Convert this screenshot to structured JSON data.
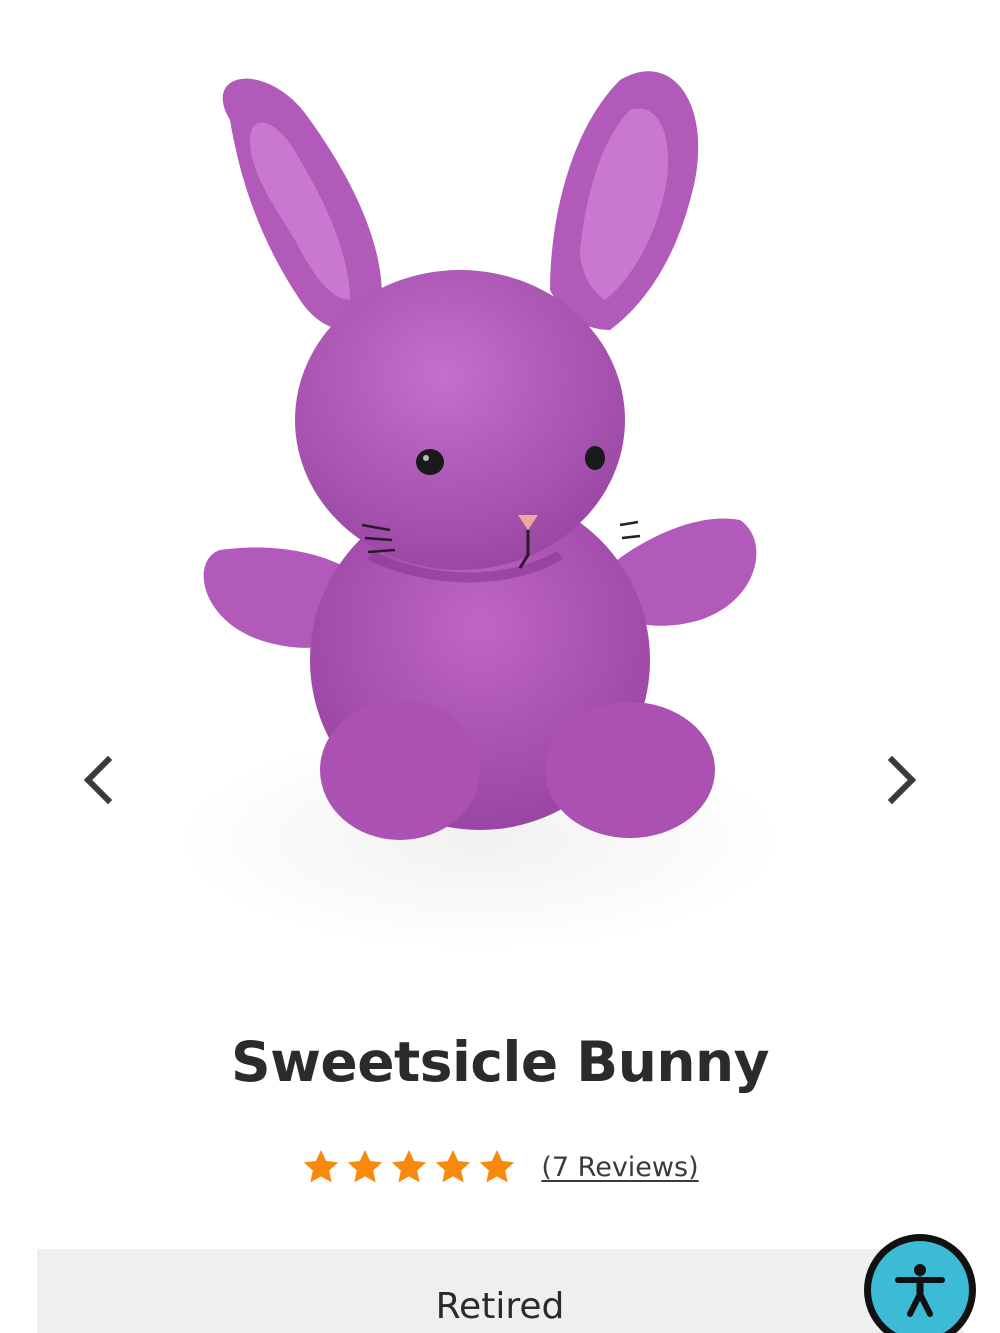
{
  "product": {
    "name": "Sweetsicle Bunny",
    "image_alt": "Purple plush bunny toy",
    "rating": 5,
    "rating_max": 5,
    "reviews_label": "(7 Reviews)",
    "status": "Retired"
  },
  "carousel": {
    "prev_icon": "chevron-left-icon",
    "next_icon": "chevron-right-icon"
  },
  "colors": {
    "plush": "#b054b8",
    "plush_dark": "#8e3d97",
    "star": "#f7890d",
    "title": "#2b2b2b",
    "status_bg": "#efefef",
    "accessibility_blue": "#3bbbd6"
  },
  "accessibility": {
    "icon": "accessibility-icon"
  }
}
